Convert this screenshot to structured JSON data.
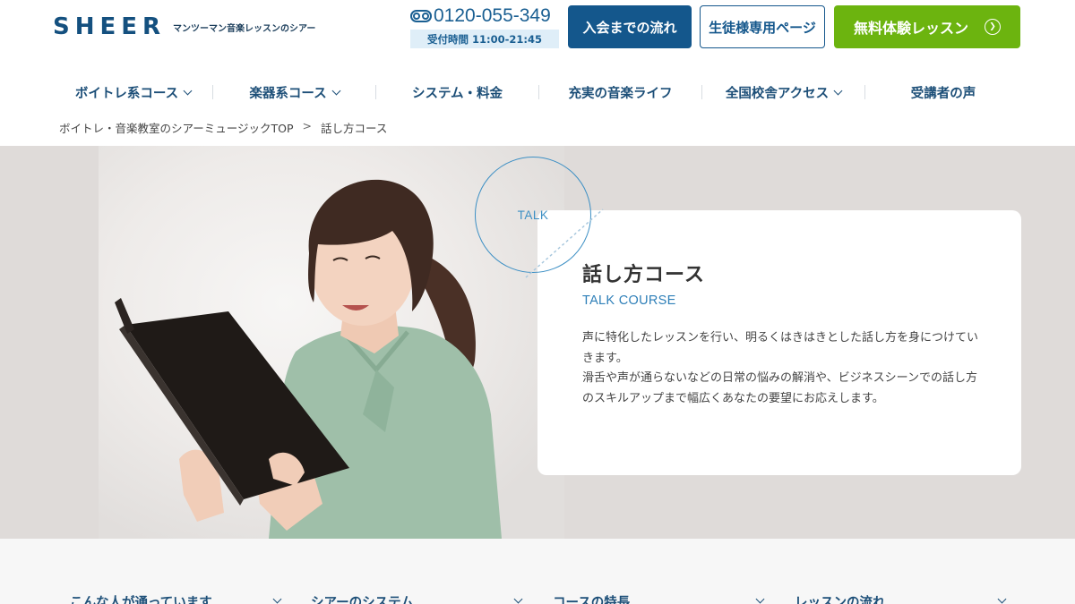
{
  "brand": {
    "logo_text": "SHEER",
    "tagline": "マンツーマン音楽レッスンのシアー",
    "primary_color": "#14578c",
    "accent_color": "#6cb40f"
  },
  "contact": {
    "phone_icon": "free-dial-icon",
    "phone": "0120-055-349",
    "hours": "受付時間 11:00-21:45"
  },
  "header_buttons": {
    "flow": "入会までの流れ",
    "student_page": "生徒様専用ページ",
    "trial": "無料体験レッスン"
  },
  "nav": [
    {
      "label": "ボイトレ系コース",
      "dropdown": true
    },
    {
      "label": "楽器系コース",
      "dropdown": true
    },
    {
      "label": "システム・料金",
      "dropdown": false
    },
    {
      "label": "充実の音楽ライフ",
      "dropdown": false
    },
    {
      "label": "全国校舎アクセス",
      "dropdown": true
    },
    {
      "label": "受講者の声",
      "dropdown": false
    }
  ],
  "breadcrumb": {
    "home": "ボイトレ・音楽教室のシアーミュージックTOP",
    "separator": ">",
    "current": "話し方コース"
  },
  "hero": {
    "circle_label": "TALK",
    "title": "話し方コース",
    "subtitle": "TALK COURSE",
    "paragraph_1": "声に特化したレッスンを行い、明るくはきはきとした話し方を身につけていきます。",
    "paragraph_2": "滑舌や声が通らないなどの日常の悩みの解消や、ビジネスシーンでの話し方のスキルアップまで幅広くあなたの要望にお応えします。"
  },
  "section_tabs": [
    {
      "label": "こんな人が通っています"
    },
    {
      "label": "シアーのシステム"
    },
    {
      "label": "コースの特長"
    },
    {
      "label": "レッスンの流れ"
    }
  ]
}
